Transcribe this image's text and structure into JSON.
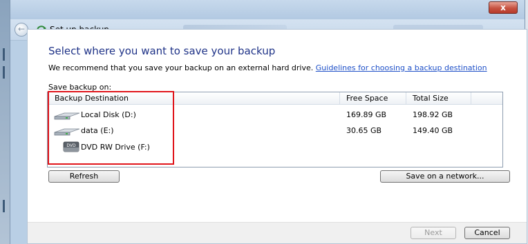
{
  "window": {
    "title": "Set up backup",
    "close_label": "x"
  },
  "heading": "Select where you want to save your backup",
  "description": {
    "text": "We recommend that you save your backup on an external hard drive.",
    "link": "Guidelines for choosing a backup destination"
  },
  "save_label": "Save backup on:",
  "columns": {
    "destination": "Backup Destination",
    "free": "Free Space",
    "total": "Total Size"
  },
  "destinations": [
    {
      "name": "Local Disk (D:)",
      "free": "169.89 GB",
      "total": "198.92 GB",
      "icon": "hard-drive-icon"
    },
    {
      "name": "data (E:)",
      "free": "30.65 GB",
      "total": "149.40 GB",
      "icon": "hard-drive-icon"
    },
    {
      "name": "DVD RW Drive (F:)",
      "free": "",
      "total": "",
      "icon": "dvd-drive-icon"
    }
  ],
  "buttons": {
    "refresh": "Refresh",
    "network": "Save on a network...",
    "next": "Next",
    "cancel": "Cancel"
  },
  "colors": {
    "heading": "#1e3287",
    "link": "#1e50c8",
    "highlight": "#e0141a"
  }
}
